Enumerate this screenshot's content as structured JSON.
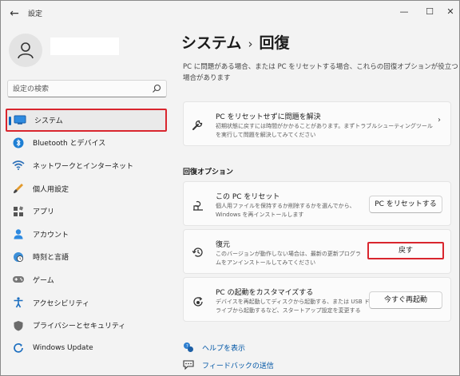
{
  "window": {
    "title": "設定",
    "back_glyph": "←",
    "minimize_glyph": "—",
    "maximize_glyph": "☐",
    "close_glyph": "✕"
  },
  "search": {
    "placeholder": "設定の検索"
  },
  "sidebar": {
    "items": [
      {
        "label": "システム",
        "icon": "system-icon",
        "selected": true
      },
      {
        "label": "Bluetooth とデバイス",
        "icon": "bluetooth-icon"
      },
      {
        "label": "ネットワークとインターネット",
        "icon": "wifi-icon"
      },
      {
        "label": "個人用設定",
        "icon": "brush-icon"
      },
      {
        "label": "アプリ",
        "icon": "apps-icon"
      },
      {
        "label": "アカウント",
        "icon": "account-icon"
      },
      {
        "label": "時刻と言語",
        "icon": "clock-globe-icon"
      },
      {
        "label": "ゲーム",
        "icon": "gamepad-icon"
      },
      {
        "label": "アクセシビリティ",
        "icon": "accessibility-icon"
      },
      {
        "label": "プライバシーとセキュリティ",
        "icon": "shield-icon"
      },
      {
        "label": "Windows Update",
        "icon": "windows-update-icon"
      }
    ]
  },
  "main": {
    "breadcrumb_parent": "システム",
    "breadcrumb_sep": "›",
    "breadcrumb_current": "回復",
    "intro_line1": "PC に問題がある場合、または PC をリセットする場合、これらの回復オプションが役立つ",
    "intro_line2": "場合があります",
    "fix_card": {
      "title": "PC をリセットせずに問題を解決",
      "desc_line1": "初期状態に戻すには時間がかかることがあります。まずトラブルシューティングツール",
      "desc_line2": "を実行して問題を解決してみてください",
      "chevron": "›"
    },
    "recovery_section_title": "回復オプション",
    "reset_card": {
      "title": "この PC をリセット",
      "desc_line1": "個人用ファイルを保持するか削除するかを選んでから、",
      "desc_line2": "Windows を再インストールします",
      "button": "PC をリセットする"
    },
    "goback_card": {
      "title": "復元",
      "desc_line1": "このバージョンが動作しない場合は、最新の更新プログラ",
      "desc_line2": "ムをアンインストールしてみてください",
      "button": "戻す"
    },
    "startup_card": {
      "title": "PC の起動をカスタマイズする",
      "desc_line1": "デバイスを再起動してディスクから起動する、または USB ド",
      "desc_line2": "ライブから起動するなど、スタートアップ設定を変更する",
      "button": "今すぐ再起動"
    },
    "links": {
      "help": "ヘルプを表示",
      "feedback": "フィードバックの送信"
    }
  },
  "colors": {
    "accent": "#0067c0",
    "highlight_border": "#d9262e",
    "background": "#f3f3f3",
    "card": "#fbfbfb"
  }
}
